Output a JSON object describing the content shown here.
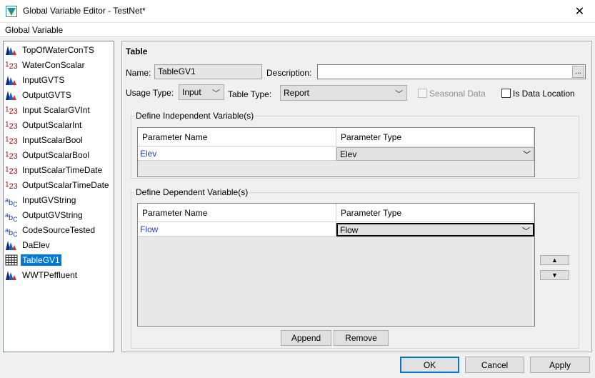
{
  "window": {
    "title": "Global Variable Editor - TestNet*",
    "close_glyph": "✕"
  },
  "menu": {
    "items": [
      "Global Variable"
    ]
  },
  "variables": [
    {
      "label": "TopOfWaterConTS",
      "icon": "timeseries-icon"
    },
    {
      "label": "WaterConScalar",
      "icon": "scalar-icon"
    },
    {
      "label": "InputGVTS",
      "icon": "timeseries-icon"
    },
    {
      "label": "OutputGVTS",
      "icon": "timeseries-icon"
    },
    {
      "label": "Input ScalarGVInt",
      "icon": "scalar-icon"
    },
    {
      "label": "OutputScalarInt",
      "icon": "scalar-icon"
    },
    {
      "label": "InputScalarBool",
      "icon": "scalar-icon"
    },
    {
      "label": "OutputScalarBool",
      "icon": "scalar-icon"
    },
    {
      "label": "InputScalarTimeDate",
      "icon": "scalar-icon"
    },
    {
      "label": "OutputScalarTimeDate",
      "icon": "scalar-icon"
    },
    {
      "label": "InputGVString",
      "icon": "string-icon"
    },
    {
      "label": "OutputGVString",
      "icon": "string-icon"
    },
    {
      "label": "CodeSourceTested",
      "icon": "string-icon"
    },
    {
      "label": "DaElev",
      "icon": "timeseries-icon"
    },
    {
      "label": "TableGV1",
      "icon": "table-icon",
      "selected": true
    },
    {
      "label": "WWTPeffluent",
      "icon": "timeseries-icon"
    }
  ],
  "icon_glyphs": {
    "scalar": {
      "digits": "1",
      "rest": "23"
    },
    "string": {
      "a": "a",
      "b": "b",
      "c": "C"
    }
  },
  "detail": {
    "heading": "Table",
    "name_label": "Name:",
    "name_value": "TableGV1",
    "description_label": "Description:",
    "description_value": "",
    "browse_label": "...",
    "usage_type_label": "Usage Type:",
    "usage_type_value": "Input",
    "table_type_label": "Table Type:",
    "table_type_value": "Report",
    "seasonal_label": "Seasonal Data",
    "seasonal_checked": false,
    "is_data_location_label": "Is Data Location",
    "is_data_location_checked": false
  },
  "independent": {
    "title": "Define Independent Variable(s)",
    "columns": [
      "Parameter Name",
      "Parameter Type"
    ],
    "rows": [
      {
        "name": "Elev",
        "type": "Elev"
      }
    ]
  },
  "dependent": {
    "title": "Define Dependent Variable(s)",
    "columns": [
      "Parameter Name",
      "Parameter Type"
    ],
    "rows": [
      {
        "name": "Flow",
        "type": "Flow"
      }
    ]
  },
  "buttons": {
    "append": "Append",
    "remove": "Remove",
    "move_up": "▲",
    "move_down": "▼",
    "ok": "OK",
    "cancel": "Cancel",
    "apply": "Apply"
  },
  "glyphs": {
    "chevron": "﹀"
  },
  "colors": {
    "selection": "#0078d7",
    "param_name": "#1a3ccc",
    "scalar_icon": "#c00000",
    "string_icon": "#1a3cc0"
  }
}
